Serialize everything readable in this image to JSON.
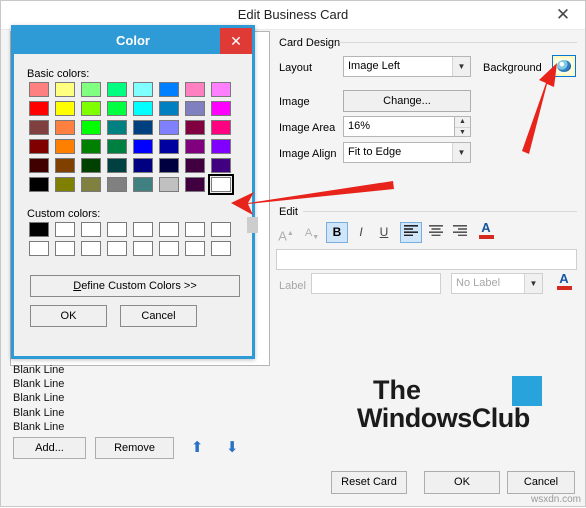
{
  "window": {
    "title": "Edit Business Card",
    "close_label": "✕"
  },
  "left": {
    "list_lines": [
      "Blank Line",
      "Blank Line",
      "Blank Line",
      "Blank Line",
      "Blank Line"
    ],
    "add_label": "Add...",
    "remove_label": "Remove",
    "move_up_icon": "arrow-up-icon",
    "move_down_icon": "arrow-down-icon"
  },
  "card_design": {
    "group_label": "Card Design",
    "layout_label": "Layout",
    "layout_value": "Image Left",
    "background_label": "Background",
    "background_swatch_icon": "color-palette-icon",
    "image_label": "Image",
    "change_label": "Change...",
    "image_area_label": "Image Area",
    "image_area_value": "16%",
    "image_align_label": "Image Align",
    "image_align_value": "Fit to Edge"
  },
  "edit": {
    "group_label": "Edit",
    "font_grow_label": "A",
    "font_shrink_label": "A",
    "bold_label": "B",
    "italic_label": "I",
    "underline_label": "U",
    "align_left_icon": "align-left-icon",
    "align_center_icon": "align-center-icon",
    "align_right_icon": "align-right-icon",
    "font_color_label": "A",
    "label_label": "Label",
    "label_value": "",
    "no_label_value": "No Label",
    "label_color_label": "A"
  },
  "logo": {
    "line1": "The",
    "line2": "WindowsClub",
    "square_color": "#29a3dc"
  },
  "bottom": {
    "reset_label": "Reset Card",
    "ok_label": "OK",
    "cancel_label": "Cancel"
  },
  "watermark": "wsxdn.com",
  "color_dialog": {
    "title": "Color",
    "close_label": "✕",
    "basic_colors_label": "Basic colors:",
    "custom_colors_label": "Custom colors:",
    "define_label": "Define Custom Colors >>",
    "ok_label": "OK",
    "cancel_label": "Cancel",
    "selected_color": "#ffffff",
    "basic_colors": [
      [
        "#ff8080",
        "#ffff80",
        "#80ff80",
        "#00ff80",
        "#80ffff",
        "#0080ff",
        "#ff80c0",
        "#ff80ff"
      ],
      [
        "#ff0000",
        "#ffff00",
        "#80ff00",
        "#00ff40",
        "#00ffff",
        "#0080c0",
        "#8080c0",
        "#ff00ff"
      ],
      [
        "#804040",
        "#ff8040",
        "#00ff00",
        "#008080",
        "#004080",
        "#8080ff",
        "#800040",
        "#ff0080"
      ],
      [
        "#800000",
        "#ff8000",
        "#008000",
        "#008040",
        "#0000ff",
        "#0000a0",
        "#800080",
        "#8000ff"
      ],
      [
        "#400000",
        "#804000",
        "#004000",
        "#004040",
        "#000080",
        "#000040",
        "#400040",
        "#400080"
      ],
      [
        "#000000",
        "#808000",
        "#808040",
        "#808080",
        "#408080",
        "#c0c0c0",
        "#400040",
        "#ffffff"
      ]
    ],
    "custom_colors": [
      [
        "#000000",
        "#ffffff",
        "#ffffff",
        "#ffffff",
        "#ffffff",
        "#ffffff",
        "#ffffff",
        "#ffffff"
      ],
      [
        "#ffffff",
        "#ffffff",
        "#ffffff",
        "#ffffff",
        "#ffffff",
        "#ffffff",
        "#ffffff",
        "#ffffff"
      ]
    ]
  },
  "annotations": {
    "arrow_color": "#e8231c",
    "arrow_top_name": "red-arrow-to-background-swatch",
    "arrow_bottom_name": "red-arrow-to-white-swatch"
  }
}
